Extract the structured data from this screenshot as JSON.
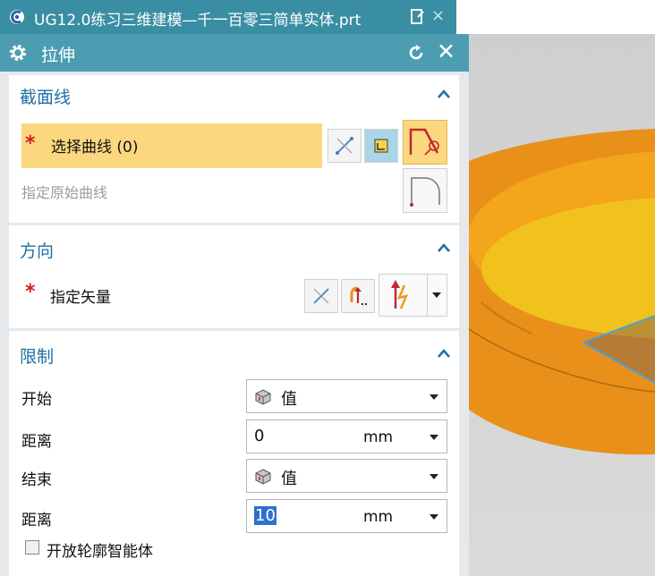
{
  "tab": {
    "title": "UG12.0练习三维建模—千一百零三简单实体.prt",
    "close": "×"
  },
  "dialog": {
    "title": "拉伸"
  },
  "section": {
    "title": "截面线",
    "select_curve": "选择曲线 (0)",
    "specify_origin_curve": "指定原始曲线"
  },
  "direction": {
    "title": "方向",
    "specify_vector": "指定矢量"
  },
  "limits": {
    "title": "限制",
    "start_label": "开始",
    "start_option": "值",
    "start_distance_label": "距离",
    "start_distance_value": "0",
    "start_distance_unit": "mm",
    "end_label": "结束",
    "end_option": "值",
    "end_distance_label": "距离",
    "end_distance_value": "10",
    "end_distance_unit": "mm",
    "open_profile_label": "开放轮廓智能体"
  },
  "colors": {
    "header": "#4d9db2",
    "tab": "#3a8ea3",
    "section_title": "#1f6fa3",
    "selection_highlight": "#fbd77f",
    "model_orange": "#f3a51c"
  }
}
